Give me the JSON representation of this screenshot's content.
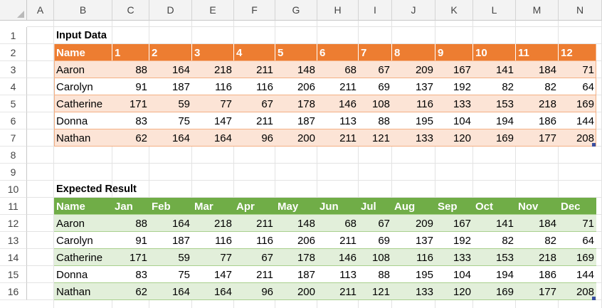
{
  "columns": [
    "A",
    "B",
    "C",
    "D",
    "E",
    "F",
    "G",
    "H",
    "I",
    "J",
    "K",
    "L",
    "M",
    "N"
  ],
  "rows": [
    "1",
    "2",
    "3",
    "4",
    "5",
    "6",
    "7",
    "8",
    "9",
    "10",
    "11",
    "12",
    "13",
    "14",
    "15",
    "16"
  ],
  "input_title": "Input Data",
  "input_headers": [
    "Name",
    "1",
    "2",
    "3",
    "4",
    "5",
    "6",
    "7",
    "8",
    "9",
    "10",
    "11",
    "12"
  ],
  "input_rows": [
    [
      "Aaron",
      "88",
      "164",
      "218",
      "211",
      "148",
      "68",
      "67",
      "209",
      "167",
      "141",
      "184",
      "71"
    ],
    [
      "Carolyn",
      "91",
      "187",
      "116",
      "116",
      "206",
      "211",
      "69",
      "137",
      "192",
      "82",
      "82",
      "64"
    ],
    [
      "Catherine",
      "171",
      "59",
      "77",
      "67",
      "178",
      "146",
      "108",
      "116",
      "133",
      "153",
      "218",
      "169"
    ],
    [
      "Donna",
      "83",
      "75",
      "147",
      "211",
      "187",
      "113",
      "88",
      "195",
      "104",
      "194",
      "186",
      "144"
    ],
    [
      "Nathan",
      "62",
      "164",
      "164",
      "96",
      "200",
      "211",
      "121",
      "133",
      "120",
      "169",
      "177",
      "208"
    ]
  ],
  "result_title": "Expected Result",
  "result_headers": [
    "Name",
    "Jan",
    "Feb",
    "Mar",
    "Apr",
    "May",
    "Jun",
    "Jul",
    "Aug",
    "Sep",
    "Oct",
    "Nov",
    "Dec"
  ],
  "result_rows": [
    [
      "Aaron",
      "88",
      "164",
      "218",
      "211",
      "148",
      "68",
      "67",
      "209",
      "167",
      "141",
      "184",
      "71"
    ],
    [
      "Carolyn",
      "91",
      "187",
      "116",
      "116",
      "206",
      "211",
      "69",
      "137",
      "192",
      "82",
      "82",
      "64"
    ],
    [
      "Catherine",
      "171",
      "59",
      "77",
      "67",
      "178",
      "146",
      "108",
      "116",
      "133",
      "153",
      "218",
      "169"
    ],
    [
      "Donna",
      "83",
      "75",
      "147",
      "211",
      "187",
      "113",
      "88",
      "195",
      "104",
      "194",
      "186",
      "144"
    ],
    [
      "Nathan",
      "62",
      "164",
      "164",
      "96",
      "200",
      "211",
      "121",
      "133",
      "120",
      "169",
      "177",
      "208"
    ]
  ],
  "colors": {
    "input_header": "#ed7d31",
    "input_band": "#fce4d6",
    "result_header": "#70ad47",
    "result_band": "#e2efda"
  }
}
